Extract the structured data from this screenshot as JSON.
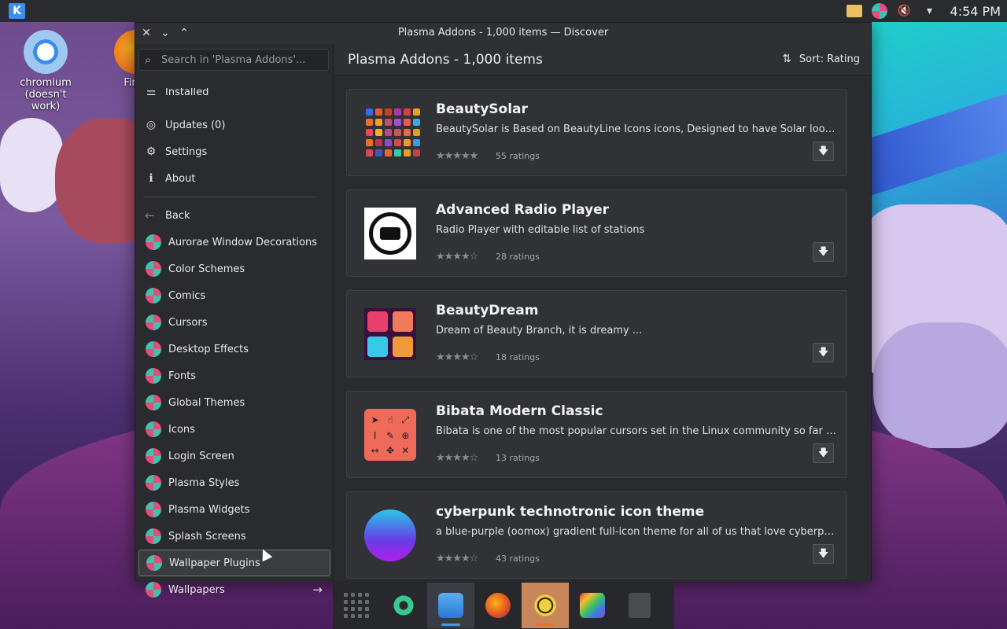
{
  "panel": {
    "clock": "4:54 PM"
  },
  "desktop_icons": [
    {
      "label": "chromium\n(doesn't work)"
    },
    {
      "label": "Fir"
    }
  ],
  "window": {
    "title": "Plasma Addons - 1,000 items — Discover"
  },
  "sidebar": {
    "search_placeholder": "Search in 'Plasma Addons'...",
    "nav": [
      {
        "label": "Installed"
      },
      {
        "label": "Updates (0)"
      },
      {
        "label": "Settings"
      },
      {
        "label": "About"
      }
    ],
    "back_label": "Back",
    "categories": [
      {
        "label": "Aurorae Window Decorations"
      },
      {
        "label": "Color Schemes"
      },
      {
        "label": "Comics"
      },
      {
        "label": "Cursors"
      },
      {
        "label": "Desktop Effects"
      },
      {
        "label": "Fonts"
      },
      {
        "label": "Global Themes"
      },
      {
        "label": "Icons"
      },
      {
        "label": "Login Screen"
      },
      {
        "label": "Plasma Styles"
      },
      {
        "label": "Plasma Widgets"
      },
      {
        "label": "Splash Screens"
      },
      {
        "label": "Wallpaper Plugins"
      },
      {
        "label": "Wallpapers"
      }
    ],
    "selected_category": "Wallpaper Plugins"
  },
  "main": {
    "header_title": "Plasma Addons - 1,000 items",
    "sort_label": "Sort: Rating",
    "items": [
      {
        "name": "BeautySolar",
        "description": "BeautySolar is Based on BeautyLine Icons icons, Designed to have Solar look and ...",
        "stars": 5,
        "ratings": "55 ratings"
      },
      {
        "name": "Advanced Radio Player",
        "description": "Radio Player with editable list of stations",
        "stars": 4,
        "ratings": "28 ratings"
      },
      {
        "name": "BeautyDream",
        "description": "Dream of Beauty Branch, it is dreamy ...",
        "stars": 4,
        "ratings": "18 ratings"
      },
      {
        "name": "Bibata Modern Classic",
        "description": "Bibata is one of the most popular cursors set in the Linux community so far and i...",
        "stars": 4,
        "ratings": "13 ratings"
      },
      {
        "name": "cyberpunk technotronic icon theme",
        "description": "a blue-purple (oomox) gradient full-icon theme for all of us that love cyberpunk, n...",
        "stars": 4,
        "ratings": "43 ratings"
      }
    ]
  },
  "colors": {
    "accent": "#3d9ee8",
    "window_bg": "#2a2b2e",
    "card_bg": "#313235"
  }
}
